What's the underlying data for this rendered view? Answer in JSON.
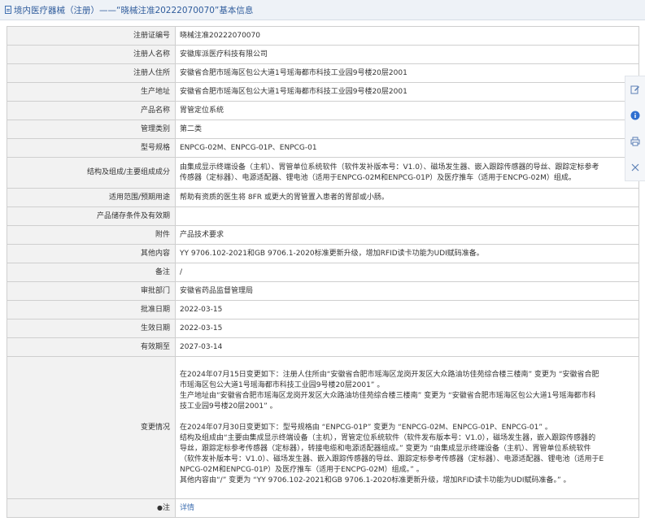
{
  "header": {
    "title": "境内医疗器械（注册）——“晓械注准20222070070”基本信息"
  },
  "rows": [
    {
      "label": "注册证编号",
      "value": "晓械注准20222070070"
    },
    {
      "label": "注册人名称",
      "value": "安徽库派医疗科技有限公司"
    },
    {
      "label": "注册人住所",
      "value": "安徽省合肥市瑶海区包公大道1号瑶海都市科技工业园9号楼20层2001"
    },
    {
      "label": "生产地址",
      "value": "安徽省合肥市瑶海区包公大道1号瑶海都市科技工业园9号楼20层2001"
    },
    {
      "label": "产品名称",
      "value": "胃管定位系统"
    },
    {
      "label": "管理类别",
      "value": "第二类"
    },
    {
      "label": "型号规格",
      "value": "ENPCG-02M、ENPCG-01P、ENPCG-01"
    },
    {
      "label": "结构及组成/主要组成成分",
      "lines": [
        "由集成显示终端设备（主机）、胃管单位系统软件（软件发补版本号：V1.0）、磁场发生器、嵌入跟踪传感器的导丝、跟踪定标参考",
        "传感器（定标器）、电源适配器、锂电池（适用于ENPCG-02M和ENPCG-01P）及医疗推车（适用于ENCPG-02M）组成。"
      ]
    },
    {
      "label": "适用范围/预期用途",
      "value": "帮助有资质的医生将 8FR 或更大的胃管置入患者的胃部或小肠。"
    },
    {
      "label": "产品储存条件及有效期",
      "value": ""
    },
    {
      "label": "附件",
      "value": "产品技术要求"
    },
    {
      "label": "其他内容",
      "value": "YY 9706.102-2021和GB 9706.1-2020标准更新升级，增加RFID读卡功能为UDI赋码准备。"
    },
    {
      "label": "备注",
      "value": "/"
    },
    {
      "label": "审批部门",
      "value": "安徽省药品监督管理局"
    },
    {
      "label": "批准日期",
      "value": "2022-03-15"
    },
    {
      "label": "生效日期",
      "value": "2022-03-15"
    },
    {
      "label": "有效期至",
      "value": "2027-03-14"
    },
    {
      "label": "变更情况",
      "lines": [
        "在2024年07月15日变更如下：注册人住所由“安徽省合肥市瑶海区龙岗开发区大众路油坊佳苑综合楼三楼南” 变更为 “安徽省合肥",
        "市瑶海区包公大道1号瑶海都市科技工业园9号楼20层2001” 。",
        "生产地址由“安徽省合肥市瑶海区龙岗开发区大众路油坊佳苑综合楼三楼南” 变更为 “安徽省合肥市瑶海区包公大道1号瑶海都市科",
        "技工业园9号楼20层2001” 。",
        "",
        "在2024年07月30日变更如下：型号规格由 “ENPCG-01P” 变更为 “ENPCG-02M、ENPCG-01P、ENPCG-01” 。",
        "结构及组成由“主要由集成显示终端设备（主机），胃管定位系统软件（软件发布版本号：V1.0），磁场发生器，嵌入跟踪传感器的",
        "导丝，跟踪定标参考传感器（定标器），转接电缆和电源适配器组成。” 变更为 “由集成显示终端设备（主机）、胃管单位系统软件",
        "（软件发补版本号：V1.0）、磁场发生器、嵌入跟踪传感器的导丝、跟踪定标参考传感器（定标器）、电源适配器、锂电池（适用于E",
        "NPCG-02M和ENPCG-01P）及医疗推车（适用于ENCPG-02M）组成。” 。",
        "其他内容由“/” 变更为 “YY 9706.102-2021和GB 9706.1-2020标准更新升级，增加RFID读卡功能为UDI赋码准备。” 。"
      ]
    },
    {
      "label": "注",
      "value": "详情",
      "is_link": true
    }
  ],
  "sidebar": [
    "edit-icon",
    "info-icon",
    "print-icon",
    "close-icon"
  ],
  "colors": {
    "link": "#3f6fb0",
    "header_bg": "#eef2f7",
    "label_bg": "#f2f2f2",
    "border": "#cfcfcf"
  }
}
